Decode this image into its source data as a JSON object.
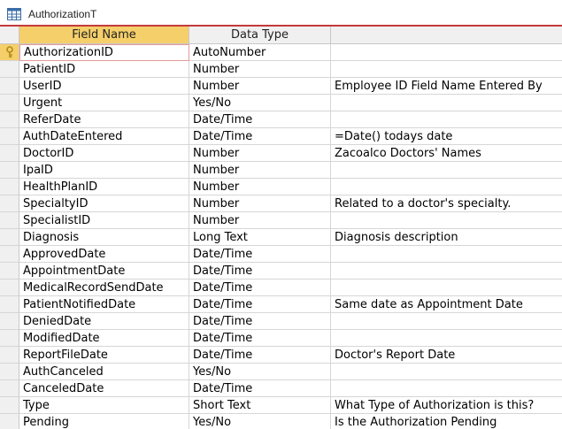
{
  "tab": {
    "title": "AuthorizationT",
    "icon": "table-icon"
  },
  "columns": {
    "field_name": "Field Name",
    "data_type": "Data Type",
    "description": ""
  },
  "colors": {
    "header_selected": "#f5cf6a",
    "tab_accent": "#c43b3b"
  },
  "rows": [
    {
      "field": "AuthorizationID",
      "type": "AutoNumber",
      "desc": "",
      "primary_key": true
    },
    {
      "field": "PatientID",
      "type": "Number",
      "desc": ""
    },
    {
      "field": "UserID",
      "type": "Number",
      "desc": "Employee ID Field Name Entered By"
    },
    {
      "field": "Urgent",
      "type": "Yes/No",
      "desc": ""
    },
    {
      "field": "ReferDate",
      "type": "Date/Time",
      "desc": ""
    },
    {
      "field": "AuthDateEntered",
      "type": "Date/Time",
      "desc": "=Date() todays date"
    },
    {
      "field": "DoctorID",
      "type": "Number",
      "desc": "Zacoalco Doctors' Names"
    },
    {
      "field": "IpaID",
      "type": "Number",
      "desc": ""
    },
    {
      "field": "HealthPlanID",
      "type": "Number",
      "desc": ""
    },
    {
      "field": "SpecialtyID",
      "type": "Number",
      "desc": "Related to a doctor's specialty."
    },
    {
      "field": "SpecialistID",
      "type": "Number",
      "desc": ""
    },
    {
      "field": "Diagnosis",
      "type": "Long Text",
      "desc": "Diagnosis description"
    },
    {
      "field": "ApprovedDate",
      "type": "Date/Time",
      "desc": ""
    },
    {
      "field": "AppointmentDate",
      "type": "Date/Time",
      "desc": ""
    },
    {
      "field": "MedicalRecordSendDate",
      "type": "Date/Time",
      "desc": ""
    },
    {
      "field": "PatientNotifiedDate",
      "type": "Date/Time",
      "desc": "Same date as Appointment Date"
    },
    {
      "field": "DeniedDate",
      "type": "Date/Time",
      "desc": ""
    },
    {
      "field": "ModifiedDate",
      "type": "Date/Time",
      "desc": ""
    },
    {
      "field": "ReportFileDate",
      "type": "Date/Time",
      "desc": "Doctor's Report Date"
    },
    {
      "field": "AuthCanceled",
      "type": "Yes/No",
      "desc": ""
    },
    {
      "field": "CanceledDate",
      "type": "Date/Time",
      "desc": ""
    },
    {
      "field": "Type",
      "type": "Short Text",
      "desc": "What Type of Authorization is this?"
    },
    {
      "field": "Pending",
      "type": "Yes/No",
      "desc": "Is the Authorization Pending"
    }
  ]
}
